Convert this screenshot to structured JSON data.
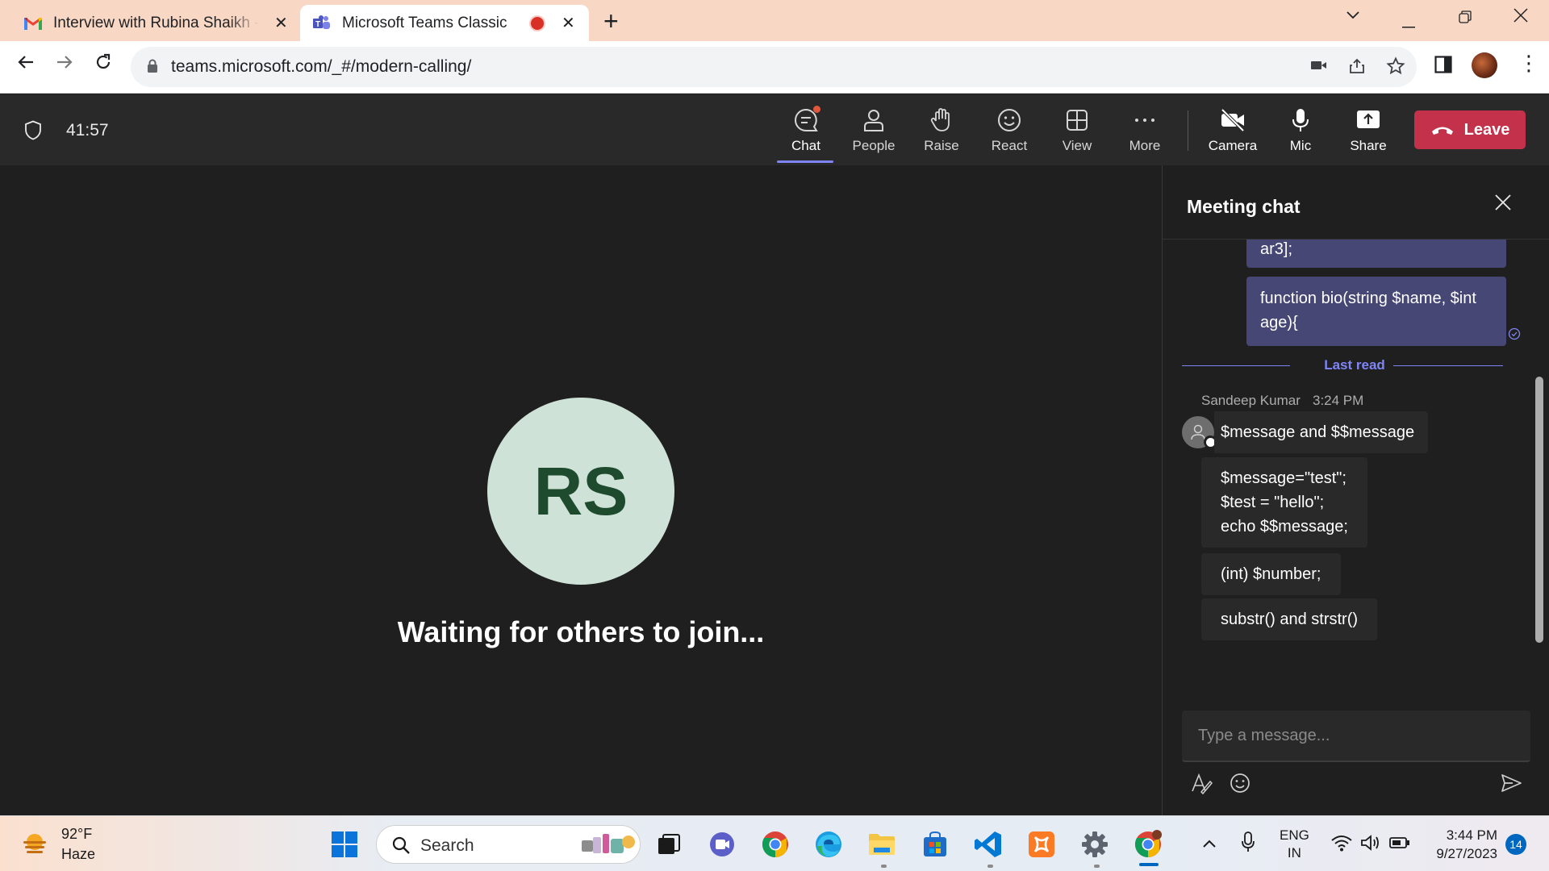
{
  "browser": {
    "tabs": [
      {
        "title": "Interview with Rubina Shaikh - P",
        "favicon": "gmail-icon"
      },
      {
        "title": "Microsoft Teams Classic",
        "favicon": "teams-icon",
        "recording": true
      }
    ],
    "url": "teams.microsoft.com/_#/modern-calling/"
  },
  "meeting": {
    "timer": "41:57",
    "controls": {
      "chat": "Chat",
      "people": "People",
      "raise": "Raise",
      "react": "React",
      "view": "View",
      "more": "More",
      "camera": "Camera",
      "mic": "Mic",
      "share": "Share",
      "leave": "Leave"
    },
    "participant_initials": "RS",
    "waiting_text": "Waiting for others to join..."
  },
  "chat": {
    "title": "Meeting chat",
    "my_messages": [
      "ar3];",
      "function bio(string $name, $int age){"
    ],
    "last_read": "Last read",
    "sender": "Sandeep Kumar",
    "sender_time": "3:24 PM",
    "messages": [
      "$message and $$message",
      "$message=\"test\";\n$test = \"hello\";\necho $$message;",
      "(int) $number;",
      "substr() and strstr()"
    ],
    "compose_placeholder": "Type a message..."
  },
  "taskbar": {
    "temperature": "92°F",
    "condition": "Haze",
    "search_label": "Search",
    "lang_line1": "ENG",
    "lang_line2": "IN",
    "time": "3:44 PM",
    "date": "9/27/2023",
    "notification_count": "14"
  },
  "colors": {
    "accent": "#7f85f5",
    "leave": "#c4314b",
    "my_bubble": "#464775",
    "avatar_bg": "#cfe2d8"
  }
}
